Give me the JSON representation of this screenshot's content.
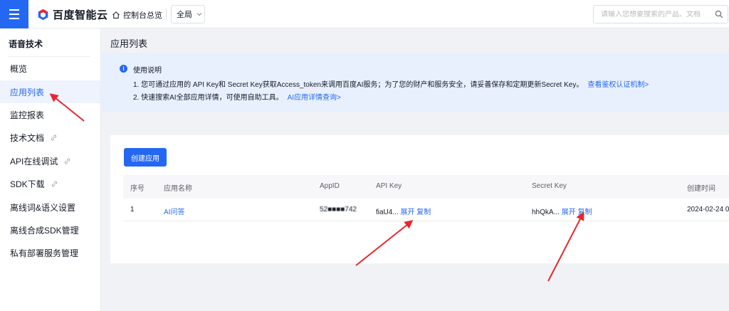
{
  "header": {
    "logo_text": "百度智能云",
    "console_label": "控制台总览",
    "region_label": "全局",
    "search_placeholder": "请输入您想要搜索的产品、文档"
  },
  "sidebar": {
    "title": "语音技术",
    "items": [
      {
        "label": "概览",
        "link_icon": false
      },
      {
        "label": "应用列表",
        "link_icon": false,
        "active": true
      },
      {
        "label": "监控报表",
        "link_icon": false
      },
      {
        "label": "技术文档",
        "link_icon": true
      },
      {
        "label": "API在线调试",
        "link_icon": true
      },
      {
        "label": "SDK下载",
        "link_icon": true
      },
      {
        "label": "离线词&语义设置",
        "link_icon": false
      },
      {
        "label": "离线合成SDK管理",
        "link_icon": false
      },
      {
        "label": "私有部署服务管理",
        "link_icon": false
      }
    ]
  },
  "main": {
    "page_title": "应用列表",
    "notice": {
      "title": "使用说明",
      "line1": "1. 您可通过应用的 API Key和 Secret Key获取Access_token来调用百度AI服务；为了您的财产和服务安全，请妥善保存和定期更新Secret Key。",
      "line1_link": "查看鉴权认证机制>",
      "line2": "2. 快速搜索AI全部应用详情，可使用自助工具。",
      "line2_link": "AI应用详情查询>"
    },
    "create_button": "创建应用",
    "table": {
      "headers": [
        "序号",
        "应用名称",
        "AppID",
        "API Key",
        "Secret Key",
        "创建时间"
      ],
      "rows": [
        {
          "index": "1",
          "name": "AI问答",
          "app_id": "52■■■■742",
          "api_key": "fiaU4...",
          "api_expand": "展开",
          "api_copy": "复制",
          "secret_key": "hhQkA...",
          "secret_expand": "展开",
          "secret_copy": "复制",
          "created": "2024-02-24 0"
        }
      ]
    }
  },
  "annotations": {
    "arrow_color": "#e8262b"
  },
  "colors": {
    "primary": "#2468f2",
    "notice_bg": "#e8f0fe"
  }
}
